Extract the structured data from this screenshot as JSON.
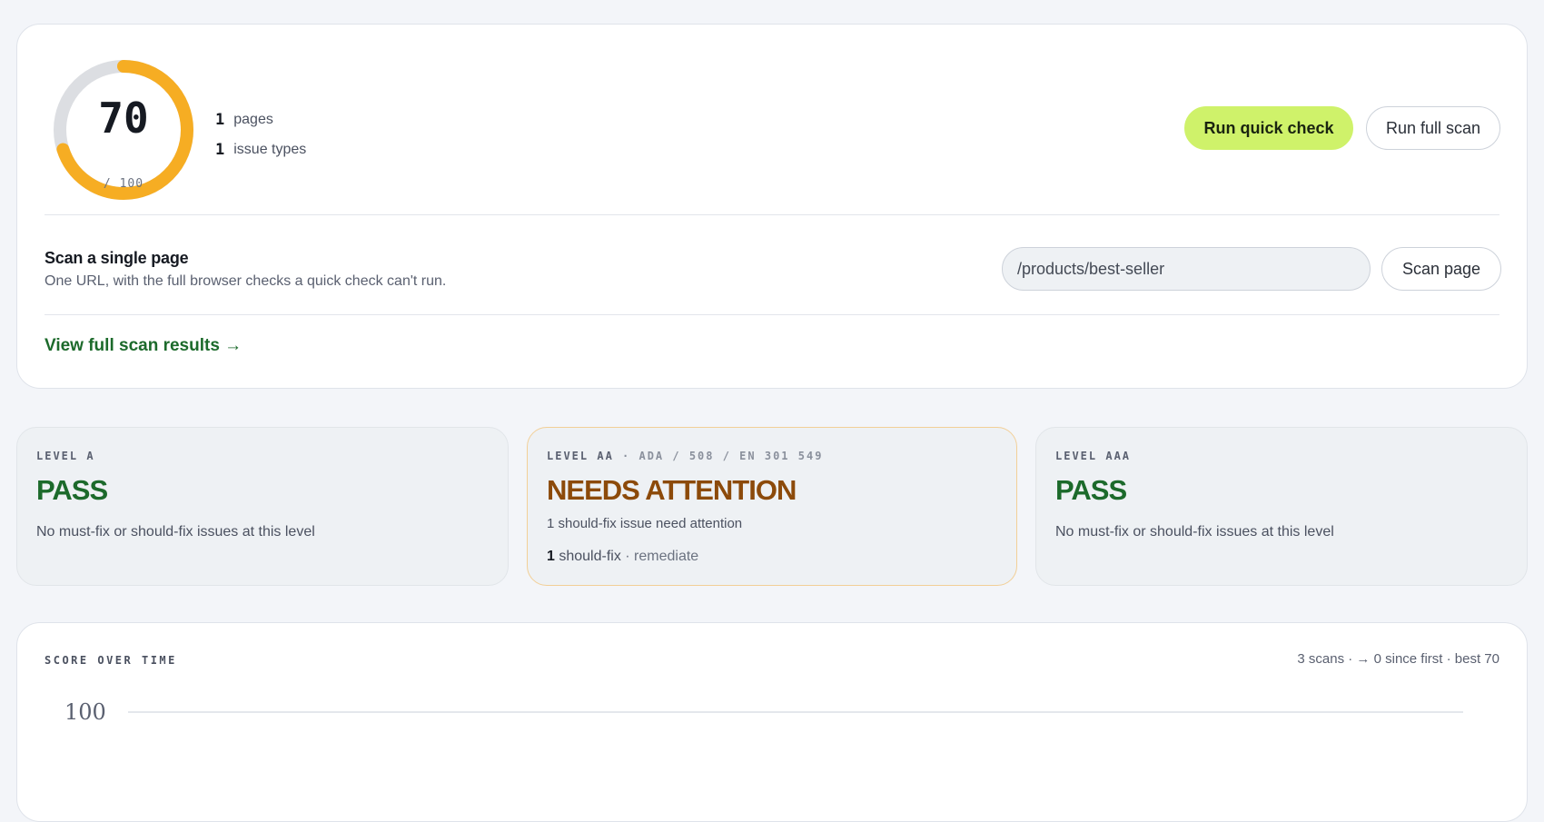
{
  "summary": {
    "score": "70",
    "score_max": "/ 100",
    "score_value": 70,
    "stats": [
      {
        "num": "1",
        "label": "pages"
      },
      {
        "num": "1",
        "label": "issue types"
      }
    ],
    "quick_check_label": "Run quick check",
    "full_scan_label": "Run full scan",
    "scan_title": "Scan a single page",
    "scan_subtitle": "One URL, with the full browser checks a quick check can't run.",
    "url_value": "/products/best-seller",
    "scan_page_label": "Scan page",
    "view_results_label": "View full scan results →"
  },
  "levels": [
    {
      "label": "LEVEL A",
      "status": "PASS",
      "description": "No must-fix or should-fix issues at this level"
    },
    {
      "label": "LEVEL AA",
      "label_suffix": " · ADA / 508 / EN 301 549",
      "status": "NEEDS ATTENTION",
      "description": "1 should-fix issue need attention",
      "count": "1",
      "count_label": " should-fix",
      "action": " · remediate"
    },
    {
      "label": "LEVEL AAA",
      "status": "PASS",
      "description": "No must-fix or should-fix issues at this level"
    }
  ],
  "score_over_time": {
    "title": "SCORE OVER TIME",
    "meta": "3 scans · → 0 since first · best 70",
    "y_label": "100"
  },
  "colors": {
    "gauge_fill": "#f6ad23",
    "gauge_track": "#dcdee2",
    "primary_button": "#cff26a",
    "pass": "#1c6a2b",
    "warning": "#8c4a0a"
  }
}
